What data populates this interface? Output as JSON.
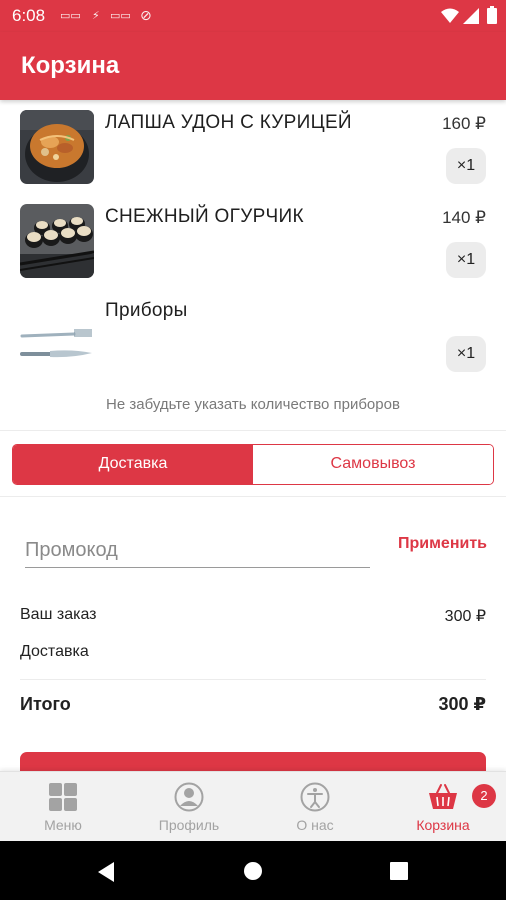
{
  "status_bar": {
    "time": "6:08"
  },
  "app_bar": {
    "title": "Корзина"
  },
  "cart": {
    "items": [
      {
        "name": "ЛАПША УДОН С КУРИЦЕЙ",
        "price": "160 ₽",
        "qty": "×1",
        "image": "noodles-photo"
      },
      {
        "name": "СНЕЖНЫЙ ОГУРЧИК",
        "price": "140 ₽",
        "qty": "×1",
        "image": "sushi-rolls-photo"
      },
      {
        "name": "Приборы",
        "price": "",
        "qty": "×1",
        "image": "cutlery-photo"
      }
    ],
    "cutlery_hint": "Не забудьте указать количество приборов"
  },
  "delivery_toggle": {
    "delivery_label": "Доставка",
    "pickup_label": "Самовывоз",
    "selected": "delivery"
  },
  "promo": {
    "placeholder": "Промокод",
    "value": "",
    "apply_label": "Применить"
  },
  "summary": {
    "order_label": "Ваш заказ",
    "order_value": "300 ₽",
    "delivery_label": "Доставка",
    "delivery_value": "",
    "total_label": "Итого",
    "total_value": "300 ₽"
  },
  "bottom_nav": {
    "items": [
      {
        "label": "Меню",
        "icon": "grid-icon",
        "active": false
      },
      {
        "label": "Профиль",
        "icon": "profile-icon",
        "active": false
      },
      {
        "label": "О нас",
        "icon": "about-icon",
        "active": false
      },
      {
        "label": "Корзина",
        "icon": "basket-icon",
        "active": true
      }
    ],
    "cart_badge": "2"
  },
  "colors": {
    "accent": "#dd3745",
    "inactive_nav": "#a3a3a3",
    "nav_background": "#f2f2f2"
  }
}
